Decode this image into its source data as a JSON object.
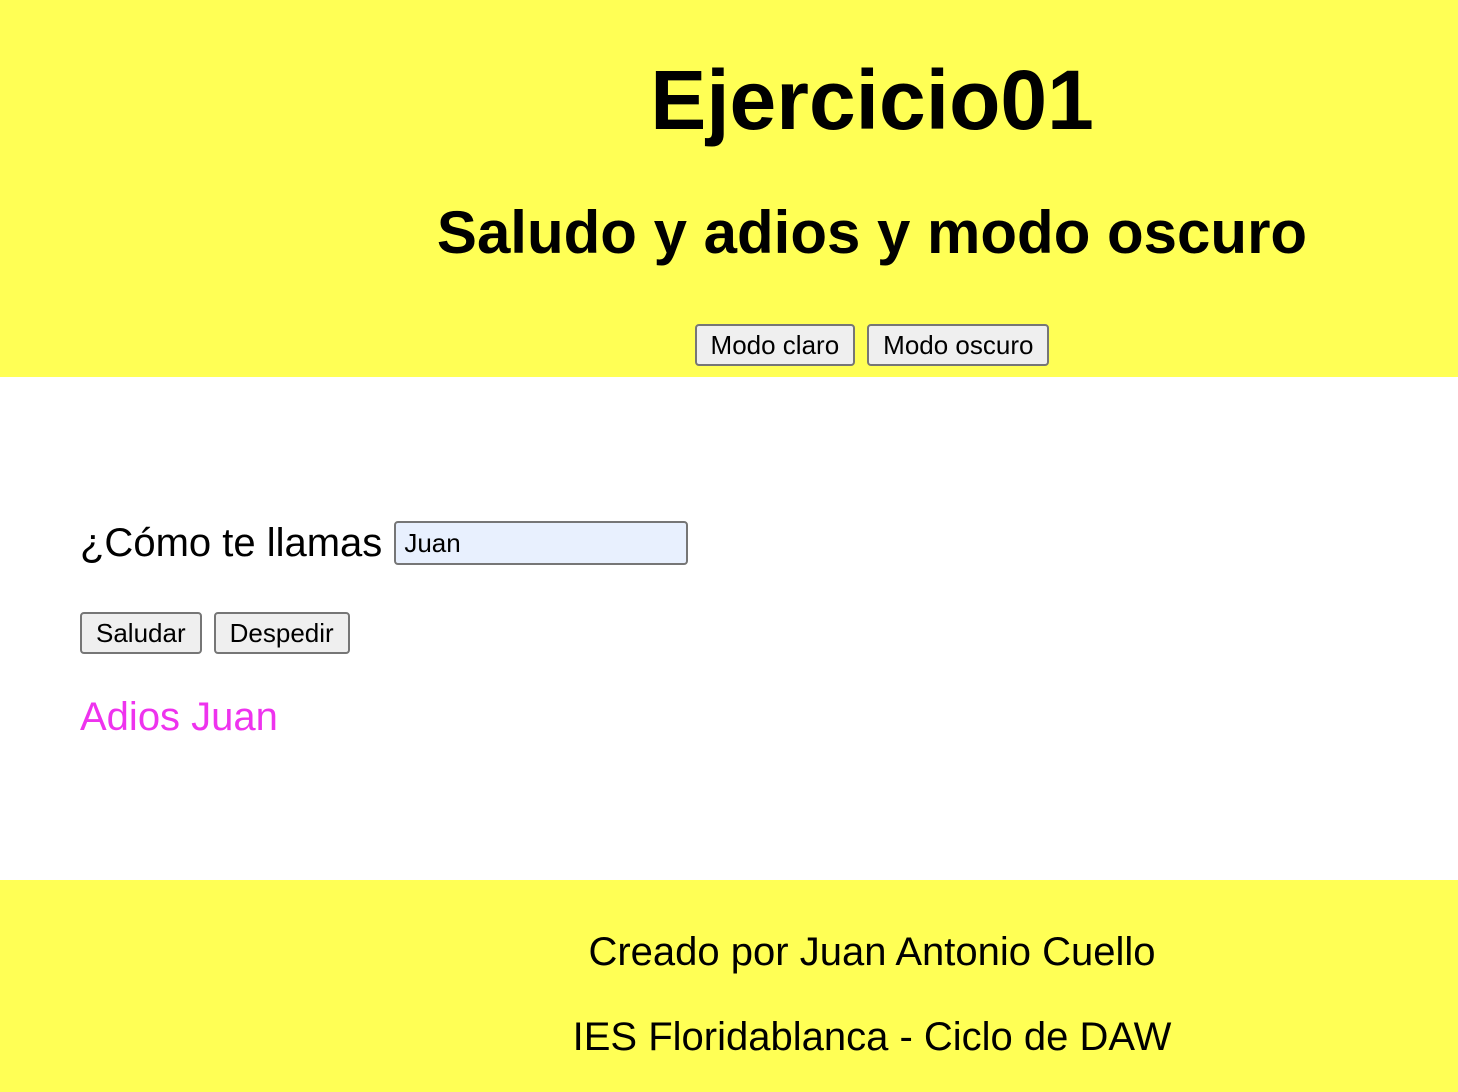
{
  "header": {
    "title": "Ejercicio01",
    "subtitle": "Saludo y adios y modo oscuro",
    "light_mode_label": "Modo claro",
    "dark_mode_label": "Modo oscuro"
  },
  "form": {
    "name_label": "¿Cómo te llamas",
    "name_value": "Juan",
    "greet_label": "Saludar",
    "farewell_label": "Despedir",
    "message": "Adios Juan"
  },
  "footer": {
    "author": "Creado por Juan Antonio Cuello",
    "institution": "IES Floridablanca - Ciclo de DAW"
  },
  "colors": {
    "header_background": "#ffff55",
    "footer_background": "#ffff55",
    "message_color": "#ee33ee",
    "input_background": "#e8f0fe"
  }
}
